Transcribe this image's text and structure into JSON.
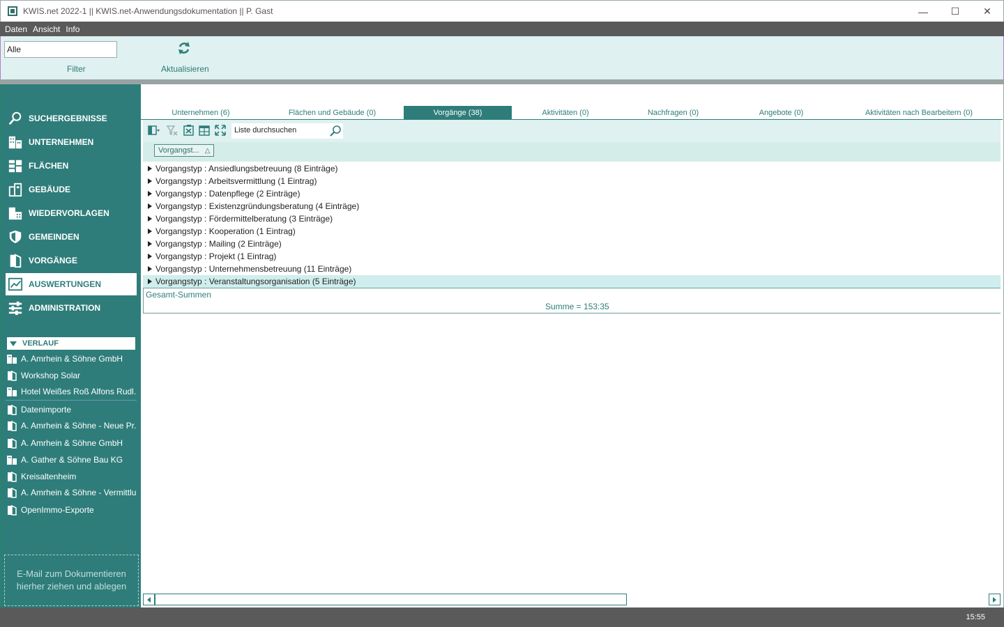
{
  "window": {
    "title": "KWIS.net 2022-1 || KWIS.net-Anwendungsdokumentation || P. Gast",
    "controls": {
      "minimize": "—",
      "maximize": "☐",
      "close": "✕"
    }
  },
  "menu": {
    "items": [
      "Daten",
      "Ansicht",
      "Info"
    ]
  },
  "ribbon": {
    "filter_value": "Alle",
    "filter_label": "Filter",
    "refresh_label": "Aktualisieren"
  },
  "sidebar": {
    "nav": [
      {
        "label": "SUCHERGEBNISSE",
        "icon": "magnifier-icon"
      },
      {
        "label": "UNTERNEHMEN",
        "icon": "company-icon"
      },
      {
        "label": "FLÄCHEN",
        "icon": "areas-icon"
      },
      {
        "label": "GEBÄUDE",
        "icon": "building-icon"
      },
      {
        "label": "WIEDERVORLAGEN",
        "icon": "resubmission-icon"
      },
      {
        "label": "GEMEINDEN",
        "icon": "shield-icon"
      },
      {
        "label": "VORGÄNGE",
        "icon": "document-icon"
      },
      {
        "label": "AUSWERTUNGEN",
        "icon": "chart-icon",
        "active": true
      },
      {
        "label": "ADMINISTRATION",
        "icon": "sliders-icon"
      }
    ],
    "history_header": "VERLAUF",
    "history": [
      "A. Amrhein & Söhne GmbH",
      "Workshop Solar",
      "Hotel Weißes Roß Alfons Rudl...",
      "Datenimporte",
      "A. Amrhein & Söhne - Neue Pr...",
      "A. Amrhein & Söhne GmbH",
      "A. Gather & Söhne Bau KG",
      "Kreisaltenheim",
      "A. Amrhein & Söhne - Vermittlu...",
      "OpenImmo-Exporte"
    ],
    "dropzone_line1": "E-Mail  zum Dokumentieren",
    "dropzone_line2": "hierher ziehen und ablegen"
  },
  "tabs": [
    "Unternehmen (6)",
    "Flächen und Gebäude (0)",
    "Vorgänge (38)",
    "Aktivitäten (0)",
    "Nachfragen (0)",
    "Angebote (0)",
    "Aktivitäten nach Bearbeitern (0)"
  ],
  "list": {
    "search_placeholder": "Liste durchsuchen",
    "group_chip": "Vorgangst...",
    "group_sort": "△",
    "rows": [
      "Vorgangstyp : Ansiedlungsbetreuung (8 Einträge)",
      "Vorgangstyp : Arbeitsvermittlung (1 Eintrag)",
      "Vorgangstyp : Datenpflege (2 Einträge)",
      "Vorgangstyp : Existenzgründungsberatung (4 Einträge)",
      "Vorgangstyp : Fördermittelberatung (3 Einträge)",
      "Vorgangstyp : Kooperation (1 Eintrag)",
      "Vorgangstyp : Mailing (2 Einträge)",
      "Vorgangstyp : Projekt (1 Eintrag)",
      "Vorgangstyp : Unternehmensbetreuung (11 Einträge)",
      "Vorgangstyp : Veranstaltungsorganisation (5 Einträge)"
    ],
    "totals_label": "Gesamt-Summen",
    "totals_sum": "Summe = 153:35"
  },
  "status": {
    "time": "15:55"
  },
  "colors": {
    "accent": "#2e7d7a",
    "ribbon": "#dff1f0",
    "bar": "#5a5a5a"
  }
}
